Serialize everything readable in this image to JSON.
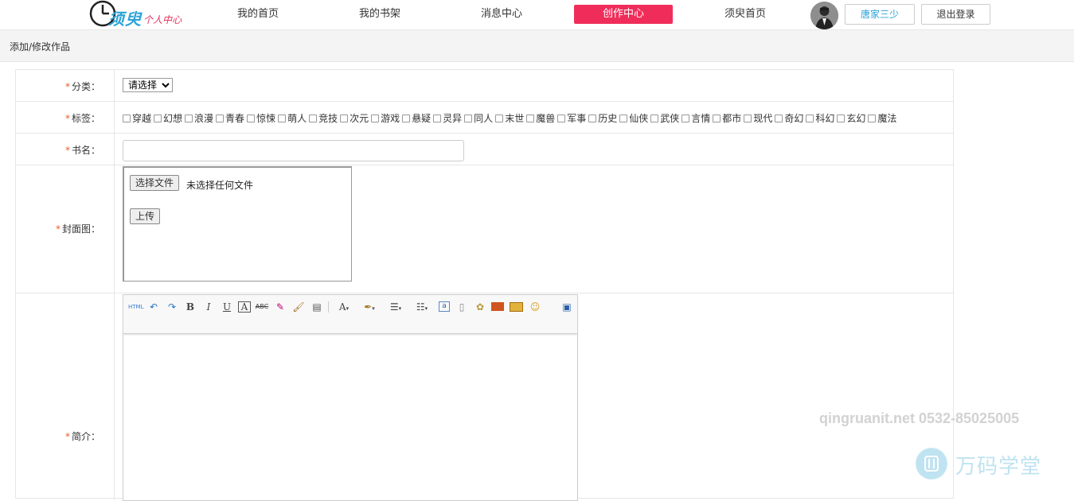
{
  "header": {
    "logo_text": "须臾",
    "logo_sub": "个人中心",
    "nav": [
      {
        "label": "我的首页"
      },
      {
        "label": "我的书架"
      },
      {
        "label": "消息中心"
      },
      {
        "label": "创作中心"
      },
      {
        "label": "须臾首页"
      }
    ],
    "active_nav": "创作中心",
    "username": "唐家三少",
    "logout_label": "退出登录",
    "accent_color": "#f02d5a",
    "username_color": "#2aa3d6"
  },
  "breadcrumb": "添加/修改作品",
  "form": {
    "category": {
      "label": "分类：",
      "selected": "请选择"
    },
    "tags": {
      "label": "标签：",
      "options": [
        "穿越",
        "幻想",
        "浪漫",
        "青春",
        "惊悚",
        "萌人",
        "竞技",
        "次元",
        "游戏",
        "悬疑",
        "灵异",
        "同人",
        "末世",
        "魔兽",
        "军事",
        "历史",
        "仙侠",
        "武侠",
        "言情",
        "都市",
        "现代",
        "奇幻",
        "科幻",
        "玄幻",
        "魔法"
      ]
    },
    "title": {
      "label": "书名：",
      "value": ""
    },
    "cover": {
      "label": "封面图：",
      "choose_label": "选择文件",
      "no_file_text": "未选择任何文件",
      "upload_label": "上传"
    },
    "intro": {
      "label": "简介：",
      "value": ""
    },
    "required_mark": "*"
  },
  "editor_toolbar": [
    "html-source-icon",
    "undo-icon",
    "redo-icon",
    "bold-icon",
    "italic-icon",
    "underline-icon",
    "font-border-icon",
    "strikethrough-icon",
    "eraser-icon",
    "format-brush-icon",
    "paste-text-icon",
    "font-color-icon",
    "highlight-color-icon",
    "ordered-list-icon",
    "unordered-list-icon",
    "anchor-icon",
    "page-icon",
    "wordimage-icon",
    "image-icon",
    "insert-picture-icon",
    "emoticon-icon",
    "fullscreen-icon"
  ],
  "watermark": {
    "contact": "qingruanit.net 0532-85025005",
    "brand": "万码学堂"
  }
}
